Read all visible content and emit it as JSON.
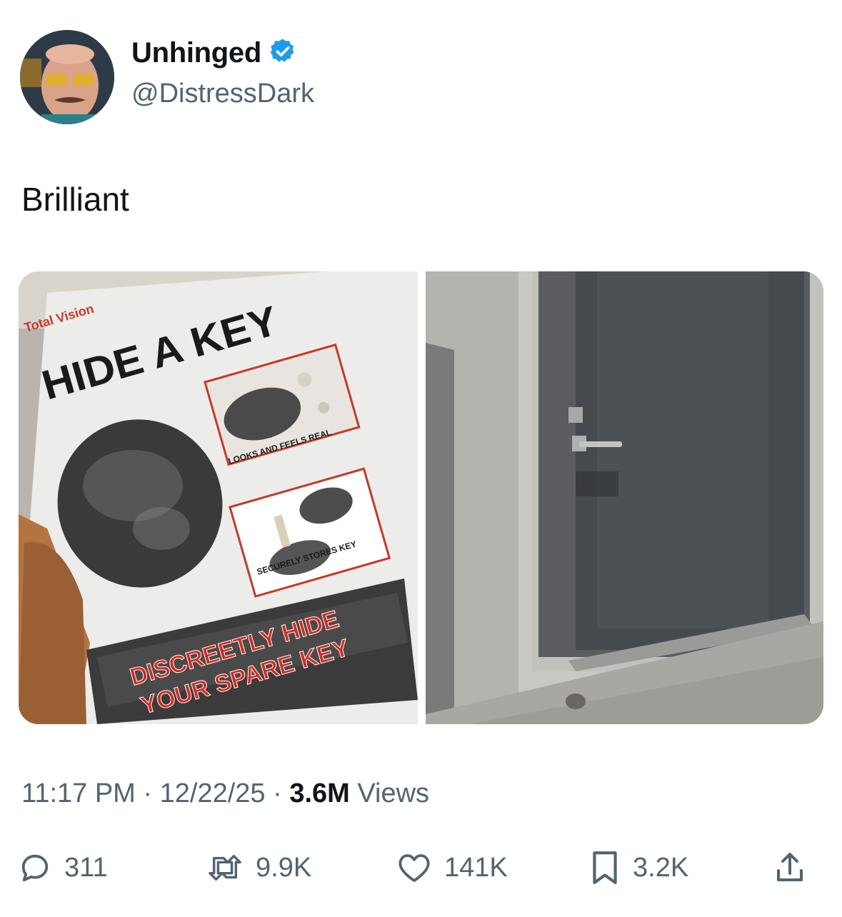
{
  "user": {
    "display_name": "Unhinged",
    "handle": "@DistressDark",
    "verified": true,
    "verified_color": "#1d9bf0"
  },
  "tweet": {
    "text": "Brilliant"
  },
  "media": {
    "left_photo": {
      "brand": "Total Vision",
      "headline": "HIDE A KEY",
      "caption_1": "LOOKS AND FEELS REAL",
      "caption_2": "SECURELY STORES KEY",
      "tagline_1": "DISCREETLY HIDE",
      "tagline_2": "YOUR SPARE KEY"
    },
    "right_photo": {}
  },
  "meta": {
    "time": "11:17 PM",
    "separator": "·",
    "date": "12/22/25",
    "views_count": "3.6M",
    "views_label": "Views"
  },
  "actions": {
    "replies": "311",
    "reposts": "9.9K",
    "likes": "141K",
    "bookmarks": "3.2K"
  },
  "icons": [
    "reply-icon",
    "repost-icon",
    "like-icon",
    "bookmark-icon",
    "share-icon",
    "verified-badge-icon"
  ]
}
